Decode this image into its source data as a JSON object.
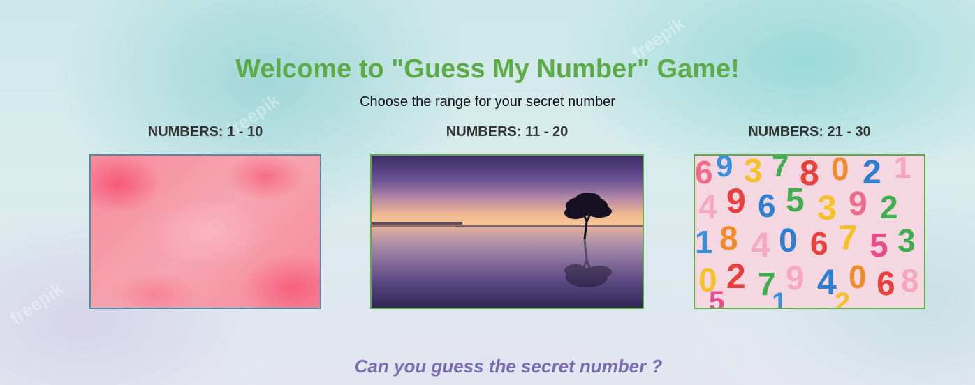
{
  "header": {
    "title": "Welcome to \"Guess My Number\" Game!",
    "subtitle": "Choose the range for your secret number"
  },
  "options": [
    {
      "label": "NUMBERS: 1 - 10",
      "image": "pink-clouds"
    },
    {
      "label": "NUMBERS: 11 - 20",
      "image": "sunset-lake-tree"
    },
    {
      "label": "NUMBERS: 21 - 30",
      "image": "colorful-numbers"
    }
  ],
  "footer": {
    "tagline": "Can you guess the secret number ?"
  },
  "colors": {
    "title": "#5cab46",
    "tagline": "#7b6bb0",
    "card_border_active": "#4a8fa6",
    "card_border": "#5cab46"
  }
}
